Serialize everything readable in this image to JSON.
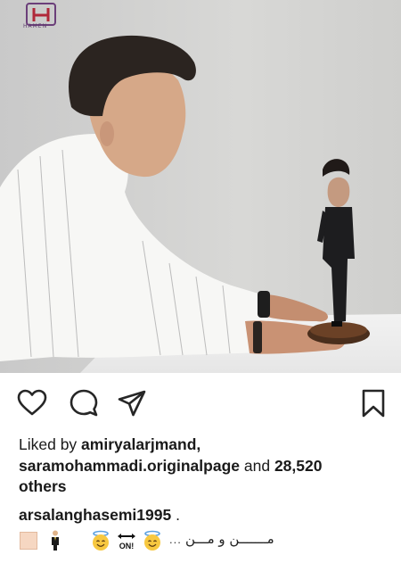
{
  "post": {
    "watermark": "HAMEN",
    "photo_description_icon": "photo-icon"
  },
  "actions": {
    "like_icon": "heart-outline-icon",
    "comment_icon": "comment-bubble-icon",
    "share_icon": "paper-plane-icon",
    "save_icon": "bookmark-icon"
  },
  "likes": {
    "prefix": "Liked by ",
    "user1": "amiryalarjmand",
    "separator": ",",
    "user2": "saramohammadi.originalpage",
    "middle": " and ",
    "count": "28,520",
    "suffix": " others"
  },
  "caption": {
    "username": "arsalanghasemi1995",
    "dot": " ."
  },
  "emoji_line": {
    "on_label": "ON!",
    "ellipsis": "...",
    "text": "مـــــــن و مـــن"
  },
  "colors": {
    "background": "#ffffff",
    "text": "#1a1a1a",
    "icon": "#262626"
  }
}
